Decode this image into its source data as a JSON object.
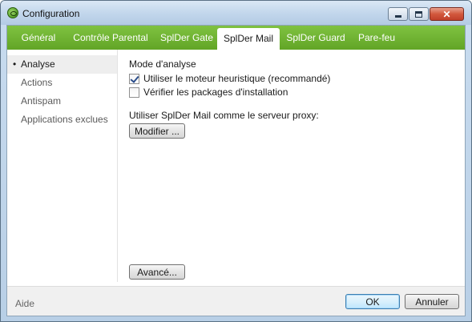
{
  "window": {
    "title": "Configuration",
    "close_glyph": "✕",
    "icon": "spider-app-icon"
  },
  "tabs": [
    {
      "label": "Général",
      "active": false
    },
    {
      "label": "Contrôle Parental",
      "active": false
    },
    {
      "label": "SplDer Gate",
      "active": false
    },
    {
      "label": "SplDer Mail",
      "active": true
    },
    {
      "label": "SplDer Guard",
      "active": false
    },
    {
      "label": "Pare-feu",
      "active": false
    }
  ],
  "sidebar": {
    "bullet": "•",
    "items": [
      {
        "label": "Analyse",
        "active": true
      },
      {
        "label": "Actions",
        "active": false
      },
      {
        "label": "Antispam",
        "active": false
      },
      {
        "label": "Applications exclues",
        "active": false
      }
    ]
  },
  "main": {
    "section_title": "Mode d'analyse",
    "options": [
      {
        "label": "Utiliser le moteur heuristique (recommandé)",
        "checked": true
      },
      {
        "label": "Vérifier les packages d'installation",
        "checked": false
      }
    ],
    "proxy_label": "Utiliser SplDer Mail comme le serveur proxy:",
    "modify_button": "Modifier ...",
    "advanced_button": "Avancé..."
  },
  "footer": {
    "help": "Aide",
    "ok": "OK",
    "cancel": "Annuler"
  },
  "colors": {
    "tabbar_green": "#6fb432",
    "accent_blue": "#3c7fb1"
  }
}
